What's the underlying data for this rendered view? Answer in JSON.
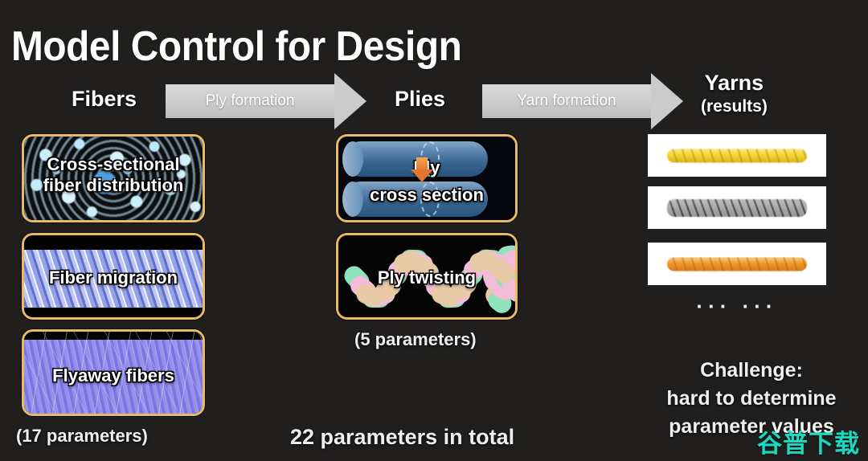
{
  "slide": {
    "title": "Model Control for Design",
    "background_color": "#201f1e",
    "accent_border_color": "#e9b964",
    "arrow_color": "#cbcbcb",
    "watermark": "谷普下载",
    "watermark_color": "#19d9c0"
  },
  "columns": {
    "fibers": {
      "heading": "Fibers",
      "param_caption": "(17 parameters)",
      "cards": [
        {
          "label_line1": "Cross-sectional",
          "label_line2": "fiber distribution",
          "texture": "cross-section-speckle"
        },
        {
          "label_line1": "Fiber migration",
          "label_line2": "",
          "texture": "twisted-fiber-bundle"
        },
        {
          "label_line1": "Flyaway fibers",
          "label_line2": "",
          "texture": "flyaway-fiber-mass"
        }
      ]
    },
    "plies": {
      "heading": "Plies",
      "param_caption": "(5 parameters)",
      "cards": [
        {
          "label_line1": "Ply",
          "label_line2": "cross section",
          "texture": "cylinder-cross-section",
          "arrow_color": "#e2762a"
        },
        {
          "label_line1": "Ply twisting",
          "label_line2": "",
          "texture": "twisted-strands"
        }
      ]
    },
    "yarns": {
      "heading": "Yarns",
      "subheading": "(results)",
      "ellipsis": "···  ···",
      "results": [
        {
          "name": "yellow-yarn",
          "color": "#f4d433"
        },
        {
          "name": "gray-yarn",
          "color": "#8d8d8d"
        },
        {
          "name": "orange-yarn",
          "color": "#f0982c"
        }
      ],
      "challenge_line1": "Challenge:",
      "challenge_line2": "hard to determine",
      "challenge_line3": "parameter values"
    }
  },
  "arrows": [
    {
      "label": "Ply formation"
    },
    {
      "label": "Yarn formation"
    }
  ],
  "totals": {
    "caption": "22 parameters in total"
  }
}
